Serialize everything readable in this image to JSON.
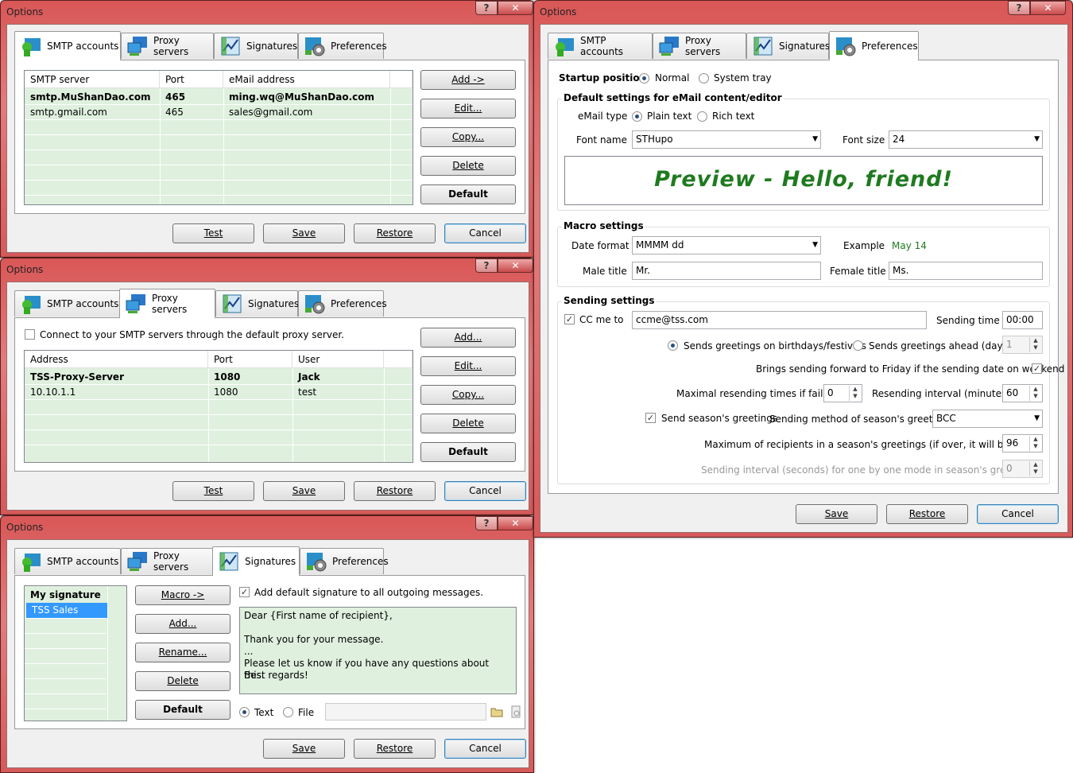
{
  "window_title": "Options",
  "tabs": [
    "SMTP accounts",
    "Proxy servers",
    "Signatures",
    "Preferences"
  ],
  "titlebar_buttons": {
    "help": "?",
    "close": "✕"
  },
  "smtp": {
    "columns": [
      "SMTP server",
      "Port",
      "eMail address"
    ],
    "rows": [
      [
        "smtp.MuShanDao.com",
        "465",
        "ming.wq@MuShanDao.com"
      ],
      [
        "smtp.gmail.com",
        "465",
        "sales@gmail.com"
      ]
    ],
    "buttons": {
      "add": "Add ->",
      "edit": "Edit...",
      "copy": "Copy...",
      "delete": "Delete",
      "default": "Default"
    },
    "footer": {
      "test": "Test",
      "save": "Save",
      "restore": "Restore",
      "cancel": "Cancel"
    }
  },
  "proxy": {
    "checkbox_label": "Connect to your SMTP servers through the default proxy server.",
    "columns": [
      "Address",
      "Port",
      "User"
    ],
    "rows": [
      [
        "TSS-Proxy-Server",
        "1080",
        "Jack"
      ],
      [
        "10.10.1.1",
        "1080",
        "test"
      ]
    ],
    "buttons": {
      "add": "Add...",
      "edit": "Edit...",
      "copy": "Copy...",
      "delete": "Delete",
      "default": "Default"
    },
    "footer": {
      "test": "Test",
      "save": "Save",
      "restore": "Restore",
      "cancel": "Cancel"
    }
  },
  "signatures": {
    "items": [
      "My signature",
      "TSS Sales"
    ],
    "buttons": {
      "macro": "Macro ->",
      "add": "Add...",
      "rename": "Rename...",
      "delete": "Delete",
      "default": "Default"
    },
    "add_default_label": "Add default signature to all outgoing messages.",
    "body_lines": [
      "Dear {First name of recipient},",
      "",
      "Thank you for your message.",
      "...",
      "Please let us know if you have any questions about this.",
      "Best regards!"
    ],
    "text_radio": "Text",
    "file_radio": "File",
    "footer": {
      "save": "Save",
      "restore": "Restore",
      "cancel": "Cancel"
    }
  },
  "prefs": {
    "startup_label": "Startup position",
    "startup_normal": "Normal",
    "startup_tray": "System tray",
    "content_group": "Default settings for eMail content/editor",
    "email_type_label": "eMail type",
    "plain_text": "Plain text",
    "rich_text": "Rich text",
    "font_name_label": "Font name",
    "font_name": "STHupo",
    "font_size_label": "Font size",
    "font_size": "24",
    "preview_text": "Preview - Hello, friend!",
    "macro_group": "Macro settings",
    "date_format_label": "Date format",
    "date_format": "MMMM dd",
    "example_label": "Example",
    "example_value": "May 14",
    "male_title_label": "Male title",
    "male_title": "Mr.",
    "female_title_label": "Female title",
    "female_title": "Ms.",
    "sending_group": "Sending settings",
    "cc_label": "CC me to",
    "cc_value": "ccme@tss.com",
    "sending_time_label": "Sending time",
    "sending_time": "00:00",
    "greet_birthday": "Sends greetings on birthdays/festivals",
    "greet_ahead": "Sends greetings ahead (days)",
    "greet_ahead_value": "1",
    "friday_label": "Brings sending forward to Friday if the sending date on weekend",
    "max_resend_label": "Maximal resending times if failed",
    "max_resend": "0",
    "resend_interval_label": "Resending interval (minutes)",
    "resend_interval": "60",
    "season_label": "Send season's greetings",
    "season_method_label": "Sending method of season's greetings",
    "season_method": "BCC",
    "max_recipients_label": "Maximum of recipients in a season's greetings (if over, it will be split)",
    "max_recipients": "96",
    "interval_seconds_label": "Sending interval (seconds) for one by one mode in season's greetings",
    "interval_seconds": "0",
    "footer": {
      "save": "Save",
      "restore": "Restore",
      "cancel": "Cancel"
    }
  },
  "colors": {
    "list_bg": "#dff0df",
    "preview_text": "#1f7a1f",
    "frame": "#d95757"
  }
}
